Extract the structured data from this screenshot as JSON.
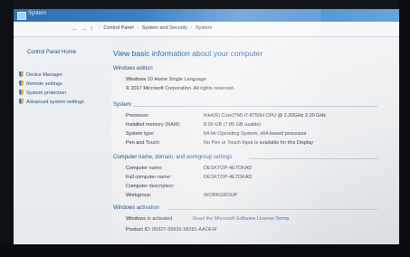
{
  "window": {
    "title": "System"
  },
  "address": {
    "crumbs": [
      "Control Panel",
      "System and Security",
      "System"
    ]
  },
  "sidebar": {
    "home": "Control Panel Home",
    "items": [
      {
        "label": "Device Manager",
        "icon": "shield-icon"
      },
      {
        "label": "Remote settings",
        "icon": "shield-icon"
      },
      {
        "label": "System protection",
        "icon": "shield-icon"
      },
      {
        "label": "Advanced system settings",
        "icon": "shield-icon"
      }
    ]
  },
  "main": {
    "heading": "View basic information about your computer",
    "edition": {
      "section": "Windows edition",
      "name": "Windows 10 Home Single Language",
      "copyright": "© 2017 Microsoft Corporation. All rights reserved."
    },
    "system": {
      "section": "System",
      "rows": [
        {
          "label": "Processor:",
          "value": "Intel(R) Core(TM) i7-8750H CPU @ 2.20GHz   2.20 GHz"
        },
        {
          "label": "Installed memory (RAM):",
          "value": "8.00 GB (7.85 GB usable)"
        },
        {
          "label": "System type:",
          "value": "64-bit Operating System, x64-based processor"
        },
        {
          "label": "Pen and Touch:",
          "value": "No Pen or Touch Input is available for this Display"
        }
      ]
    },
    "computer": {
      "section": "Computer name, domain, and workgroup settings",
      "rows": [
        {
          "label": "Computer name:",
          "value": "DESKTOP-4E7OKAD"
        },
        {
          "label": "Full computer name:",
          "value": "DESKTOP-4E7OKAD"
        },
        {
          "label": "Computer description:",
          "value": ""
        },
        {
          "label": "Workgroup:",
          "value": "WORKGROUP"
        }
      ]
    },
    "activation": {
      "section": "Windows activation",
      "status": "Windows is activated",
      "license_link": "Read the Microsoft Software License Terms",
      "product_id": "Product ID: 00327-35826-38281-AAOEM"
    }
  },
  "colors": {
    "titlebar": "#2f6fb3",
    "link": "#1f5fb0",
    "heading": "#1f5f9e"
  }
}
